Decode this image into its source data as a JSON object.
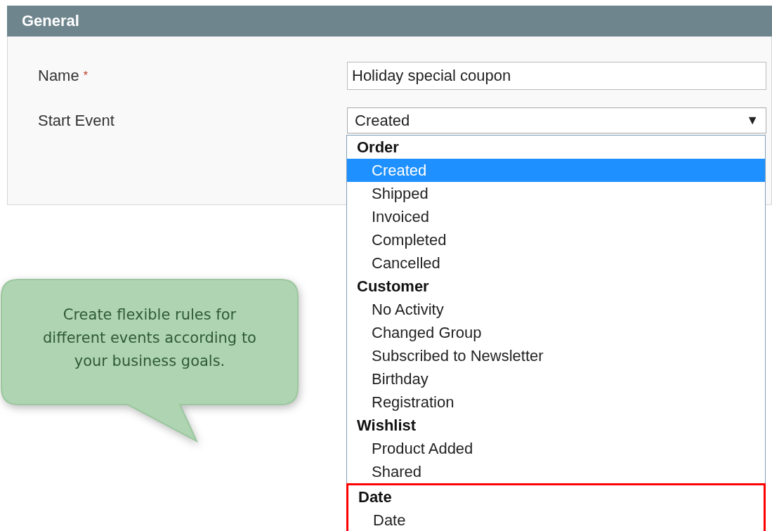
{
  "panel": {
    "title": "General"
  },
  "fields": [
    {
      "label": "Name",
      "required": true,
      "marker": "*",
      "kind": "text",
      "value": "Holiday special coupon"
    },
    {
      "label": "Start Event",
      "kind": "select",
      "value": "Created",
      "caret": "▼"
    }
  ],
  "dropdown": {
    "groups": [
      {
        "label": "Order",
        "highlighted": false,
        "options": [
          {
            "label": "Created",
            "selected": true
          },
          {
            "label": "Shipped",
            "selected": false
          },
          {
            "label": "Invoiced",
            "selected": false
          },
          {
            "label": "Completed",
            "selected": false
          },
          {
            "label": "Cancelled",
            "selected": false
          }
        ]
      },
      {
        "label": "Customer",
        "highlighted": false,
        "options": [
          {
            "label": "No Activity",
            "selected": false
          },
          {
            "label": "Changed Group",
            "selected": false
          },
          {
            "label": "Subscribed to Newsletter",
            "selected": false
          },
          {
            "label": "Birthday",
            "selected": false
          },
          {
            "label": "Registration",
            "selected": false
          }
        ]
      },
      {
        "label": "Wishlist",
        "highlighted": false,
        "options": [
          {
            "label": "Product Added",
            "selected": false
          },
          {
            "label": "Shared",
            "selected": false
          }
        ]
      },
      {
        "label": "Date",
        "highlighted": true,
        "options": [
          {
            "label": "Date",
            "selected": false
          }
        ]
      }
    ]
  },
  "callout": {
    "text": "Create flexible rules for different events according to your business goals."
  }
}
